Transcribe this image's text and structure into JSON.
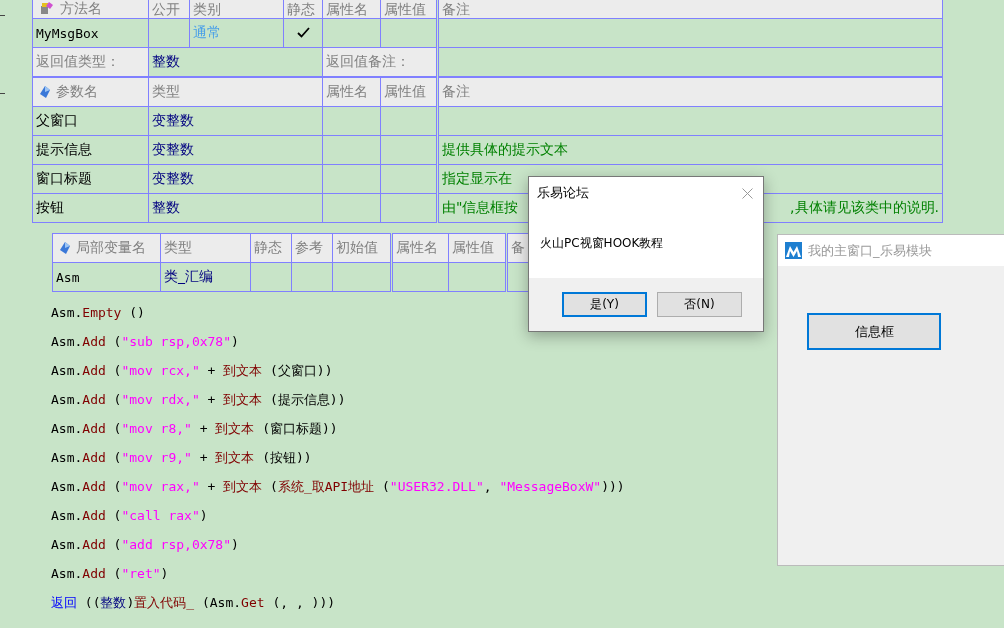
{
  "method_table": {
    "columns": [
      "方法名",
      "公开",
      "类别",
      "静态",
      "属性名",
      "属性值",
      "备注"
    ],
    "method": {
      "name": "MyMsgBox",
      "category": "通常",
      "static": true
    },
    "return_type_label": "返回值类型：",
    "return_type": "整数",
    "return_note_label": "返回值备注："
  },
  "params_table": {
    "columns": [
      "参数名",
      "类型",
      "属性名",
      "属性值",
      "备注"
    ],
    "rows": [
      {
        "name": "父窗口",
        "type": "变整数"
      },
      {
        "name": "提示信息",
        "type": "变整数",
        "note": "提供具体的提示文本"
      },
      {
        "name": "窗口标题",
        "type": "变整数",
        "note": "指定显示在"
      },
      {
        "name": "按钮",
        "type": "整数",
        "note": "由\"信息框按",
        "note_end": ",具体请见该类中的说明."
      }
    ]
  },
  "locals_table": {
    "columns": [
      "局部变量名",
      "类型",
      "静态",
      "参考",
      "初始值",
      "属性名",
      "属性值",
      "备"
    ],
    "rows": [
      {
        "name": "Asm",
        "type": "类_汇编"
      }
    ]
  },
  "code_lines": [
    [
      {
        "kind": "text",
        "text": "Asm."
      },
      {
        "kind": "method",
        "text": "Empty"
      },
      {
        "kind": "text",
        "text": " ()"
      }
    ],
    [
      {
        "kind": "text",
        "text": "Asm."
      },
      {
        "kind": "method",
        "text": "Add"
      },
      {
        "kind": "text",
        "text": " ("
      },
      {
        "kind": "string",
        "text": "\"sub rsp,0x78\""
      },
      {
        "kind": "text",
        "text": ")"
      }
    ],
    [
      {
        "kind": "text",
        "text": "Asm."
      },
      {
        "kind": "method",
        "text": "Add"
      },
      {
        "kind": "text",
        "text": " ("
      },
      {
        "kind": "string",
        "text": "\"mov rcx,\""
      },
      {
        "kind": "text",
        "text": " + "
      },
      {
        "kind": "method",
        "text": "到文本"
      },
      {
        "kind": "text",
        "text": " (父窗口))"
      }
    ],
    [
      {
        "kind": "text",
        "text": "Asm."
      },
      {
        "kind": "method",
        "text": "Add"
      },
      {
        "kind": "text",
        "text": " ("
      },
      {
        "kind": "string",
        "text": "\"mov rdx,\""
      },
      {
        "kind": "text",
        "text": " + "
      },
      {
        "kind": "method",
        "text": "到文本"
      },
      {
        "kind": "text",
        "text": " (提示信息))"
      }
    ],
    [
      {
        "kind": "text",
        "text": "Asm."
      },
      {
        "kind": "method",
        "text": "Add"
      },
      {
        "kind": "text",
        "text": " ("
      },
      {
        "kind": "string",
        "text": "\"mov r8,\""
      },
      {
        "kind": "text",
        "text": " + "
      },
      {
        "kind": "method",
        "text": "到文本"
      },
      {
        "kind": "text",
        "text": " (窗口标题))"
      }
    ],
    [
      {
        "kind": "text",
        "text": "Asm."
      },
      {
        "kind": "method",
        "text": "Add"
      },
      {
        "kind": "text",
        "text": " ("
      },
      {
        "kind": "string",
        "text": "\"mov r9,\""
      },
      {
        "kind": "text",
        "text": " + "
      },
      {
        "kind": "method",
        "text": "到文本"
      },
      {
        "kind": "text",
        "text": " (按钮))"
      }
    ],
    [
      {
        "kind": "text",
        "text": "Asm."
      },
      {
        "kind": "method",
        "text": "Add"
      },
      {
        "kind": "text",
        "text": " ("
      },
      {
        "kind": "string",
        "text": "\"mov rax,\""
      },
      {
        "kind": "text",
        "text": " + "
      },
      {
        "kind": "method",
        "text": "到文本"
      },
      {
        "kind": "text",
        "text": " ("
      },
      {
        "kind": "method",
        "text": "系统_取API地址"
      },
      {
        "kind": "text",
        "text": " ("
      },
      {
        "kind": "string",
        "text": "\"USER32.DLL\""
      },
      {
        "kind": "text",
        "text": ", "
      },
      {
        "kind": "string",
        "text": "\"MessageBoxW\""
      },
      {
        "kind": "text",
        "text": ")))"
      }
    ],
    [
      {
        "kind": "text",
        "text": "Asm."
      },
      {
        "kind": "method",
        "text": "Add"
      },
      {
        "kind": "text",
        "text": " ("
      },
      {
        "kind": "string",
        "text": "\"call rax\""
      },
      {
        "kind": "text",
        "text": ")"
      }
    ],
    [
      {
        "kind": "text",
        "text": "Asm."
      },
      {
        "kind": "method",
        "text": "Add"
      },
      {
        "kind": "text",
        "text": " ("
      },
      {
        "kind": "string",
        "text": "\"add rsp,0x78\""
      },
      {
        "kind": "text",
        "text": ")"
      }
    ],
    [
      {
        "kind": "text",
        "text": "Asm."
      },
      {
        "kind": "method",
        "text": "Add"
      },
      {
        "kind": "text",
        "text": " ("
      },
      {
        "kind": "string",
        "text": "\"ret\""
      },
      {
        "kind": "text",
        "text": ")"
      }
    ],
    [
      {
        "kind": "keyword",
        "text": "返回"
      },
      {
        "kind": "text",
        "text": " (("
      },
      {
        "kind": "type",
        "text": "整数"
      },
      {
        "kind": "text",
        "text": ")"
      },
      {
        "kind": "method",
        "text": "置入代码_"
      },
      {
        "kind": "text",
        "text": " (Asm."
      },
      {
        "kind": "method",
        "text": "Get"
      },
      {
        "kind": "text",
        "text": " (, , )))"
      }
    ]
  ],
  "message_box": {
    "title": "乐易论坛",
    "message": "火山PC视窗HOOK教程",
    "buttons": [
      {
        "label": "是(Y)",
        "selected": true
      },
      {
        "label": "否(N)",
        "selected": false
      }
    ]
  },
  "main_window": {
    "title": "我的主窗口_乐易模块",
    "button": "信息框"
  }
}
